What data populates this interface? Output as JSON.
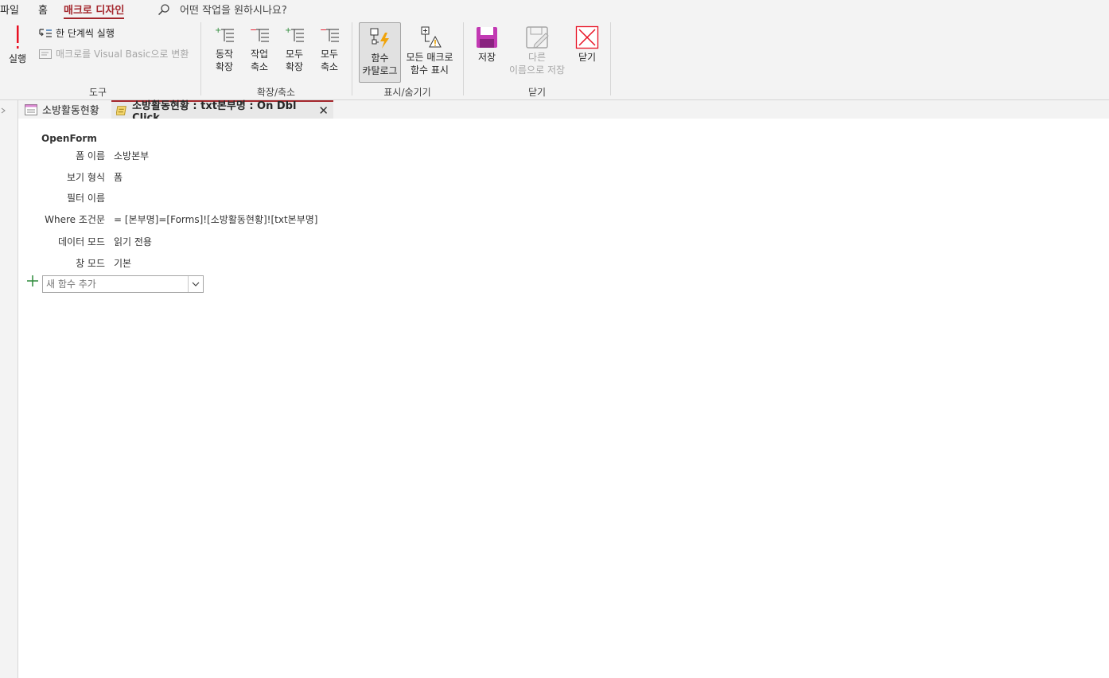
{
  "menu": {
    "file": "파일",
    "home": "홈",
    "macro_design": "매크로 디자인",
    "tell_me": "어떤 작업을 원하시나요?"
  },
  "ribbon": {
    "tools": {
      "run": "실행",
      "single_step": "한 단계씩 실행",
      "convert_vb": "매크로를 Visual Basic으로 변환",
      "label": "도구"
    },
    "collapse_expand": {
      "expand_actions": [
        "동작",
        "확장"
      ],
      "collapse_actions": [
        "작업",
        "축소"
      ],
      "expand_all": [
        "모두",
        "확장"
      ],
      "collapse_all": [
        "모두",
        "축소"
      ],
      "label": "확장/축소"
    },
    "show_hide": {
      "action_catalog": [
        "함수",
        "카탈로그"
      ],
      "show_all_actions": [
        "모든 매크로",
        "함수 표시"
      ],
      "label": "표시/숨기기"
    },
    "close": {
      "save": "저장",
      "save_as": [
        "다른",
        "이름으로 저장"
      ],
      "close": "닫기",
      "label": "닫기"
    }
  },
  "tabs": [
    {
      "label": "소방활동현황"
    },
    {
      "label": "소방활동현황 : txt본부명 : On Dbl Click",
      "close": "✕"
    }
  ],
  "macro": {
    "action": "OpenForm",
    "arguments": [
      {
        "label": "폼 이름",
        "value": "소방본부"
      },
      {
        "label": "보기 형식",
        "value": "폼"
      },
      {
        "label": "필터 이름",
        "value": ""
      },
      {
        "label": "Where 조건문",
        "value": "= [본부명]=[Forms]![소방활동현황]![txt본부명]"
      },
      {
        "label": "데이터 모드",
        "value": "읽기 전용"
      },
      {
        "label": "창 모드",
        "value": "기본"
      }
    ],
    "add_new_action_placeholder": "새 함수 추가"
  },
  "colors": {
    "accent": "#a4262c",
    "ribbon_bg": "#f3f3f3",
    "add_plus": "#2e8b3a"
  }
}
